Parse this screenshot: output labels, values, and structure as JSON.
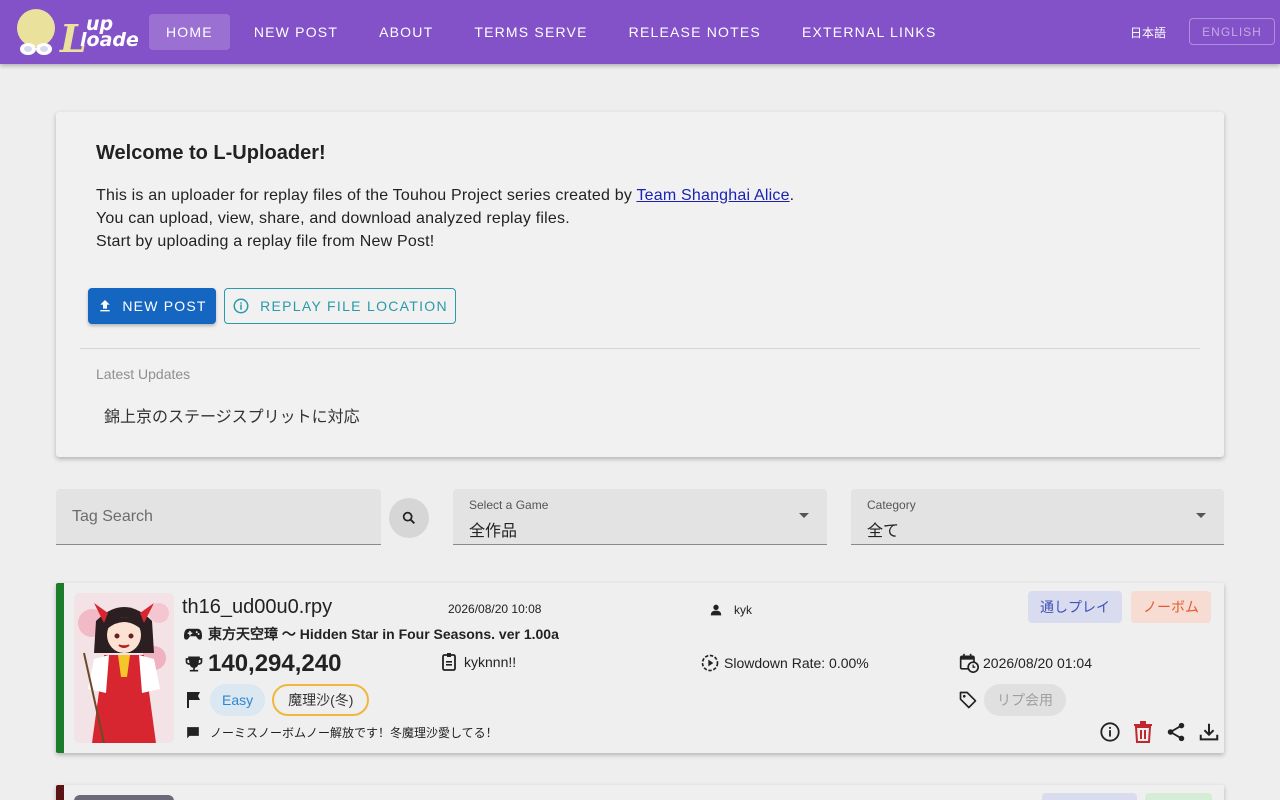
{
  "header": {
    "logo_text": "up Loader",
    "nav": [
      {
        "label": "HOME",
        "active": true
      },
      {
        "label": "NEW POST",
        "active": false
      },
      {
        "label": "ABOUT",
        "active": false
      },
      {
        "label": "TERMS SERVE",
        "active": false
      },
      {
        "label": "RELEASE NOTES",
        "active": false
      },
      {
        "label": "EXTERNAL LINKS",
        "active": false
      }
    ],
    "lang_ja": "日本語",
    "lang_en": "ENGLISH"
  },
  "welcome": {
    "title": "Welcome to L-Uploader!",
    "line1_prefix": "This is an uploader for replay files of the Touhou Project series created by ",
    "line1_link": "Team Shanghai Alice",
    "line1_suffix": ".",
    "line2": "You can upload, view, share, and download analyzed replay files.",
    "line3": "Start by uploading a replay file from New Post!",
    "new_post_button": "NEW POST",
    "replay_location_button": "REPLAY FILE LOCATION",
    "updates_label": "Latest Updates",
    "updates": [
      "錦上京のステージスプリットに対応"
    ]
  },
  "filters": {
    "tag_search_placeholder": "Tag Search",
    "game_label": "Select a Game",
    "game_value": "全作品",
    "category_label": "Category",
    "category_value": "全て"
  },
  "replays": [
    {
      "filename": "th16_ud00u0.rpy",
      "posted_at": "2026/08/20 10:08",
      "poster": "kyk",
      "category": "通しプレイ",
      "nobomb": "ノーボム",
      "game": "東方天空璋 〜 Hidden Star in Four Seasons. ver 1.00a",
      "score": "140,294,240",
      "player": "kyknnn!!",
      "slowdown": "Slowdown Rate: 0.00%",
      "played_at": "2026/08/20 01:04",
      "difficulty": "Easy",
      "character": "魔理沙(冬)",
      "tag": "リプ会用",
      "comment": "ノーミスノーボムノー解放です！冬魔理沙愛してる！"
    }
  ],
  "colors": {
    "header": "#8452c8",
    "primary_button": "#1566c0",
    "outline_button": "#2a9aa8",
    "card_stripe_1": "#1b7d2a",
    "card_stripe_2": "#5b1414",
    "delete_icon": "#c0282d"
  }
}
